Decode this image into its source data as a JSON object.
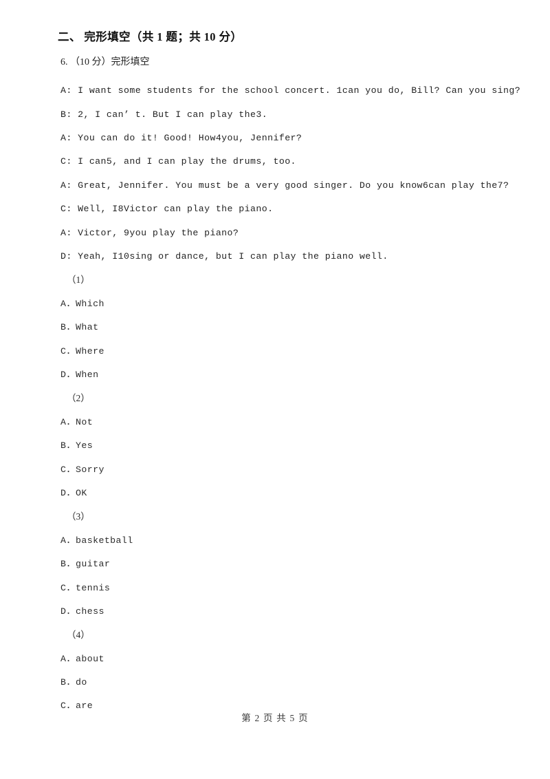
{
  "document": {
    "section_heading": "二、 完形填空（共 1 题；共 10 分）",
    "question_stem": "6. （10 分）完形填空",
    "dialogue": [
      "A: I want some students for the school concert. 1can you do, Bill? Can you sing?",
      "B: 2, I can’ t. But I can play the3.",
      "A: You can do it! Good! How4you, Jennifer?",
      "C: I can5, and I can play the drums, too.",
      "A: Great, Jennifer. You must be a very good singer. Do you know6can play the7?",
      "C: Well, I8Victor can play the piano.",
      "A: Victor, 9you play the piano?",
      "D: Yeah, I10sing or dance, but I can play the piano well."
    ],
    "option_groups": [
      {
        "number": "（1）",
        "options": [
          "A．Which",
          "B．What",
          "C．Where",
          "D．When"
        ]
      },
      {
        "number": "（2）",
        "options": [
          "A．Not",
          "B．Yes",
          "C．Sorry",
          "D．OK"
        ]
      },
      {
        "number": "（3）",
        "options": [
          "A．basketball",
          "B．guitar",
          "C．tennis",
          "D．chess"
        ]
      },
      {
        "number": "（4）",
        "options": [
          "A．about",
          "B．do",
          "C．are"
        ]
      }
    ],
    "footer": "第 2 页 共 5 页"
  }
}
